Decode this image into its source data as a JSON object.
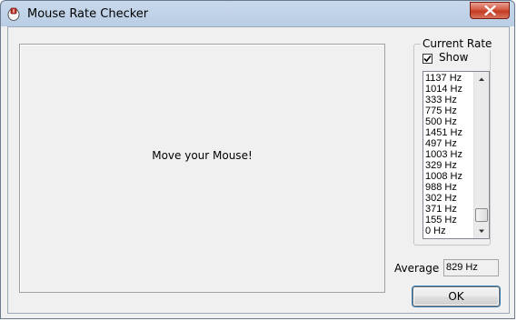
{
  "window": {
    "title": "Mouse Rate Checker"
  },
  "main": {
    "message": "Move your Mouse!"
  },
  "current_rate": {
    "group_label": "Current Rate",
    "show_label": "Show",
    "show_checked": true,
    "items": [
      "1137 Hz",
      "1014 Hz",
      "333 Hz",
      "775 Hz",
      "500 Hz",
      "1451 Hz",
      "497 Hz",
      "1003 Hz",
      "329 Hz",
      "1008 Hz",
      "988 Hz",
      "302 Hz",
      "371 Hz",
      "155 Hz",
      "0 Hz"
    ]
  },
  "average": {
    "label": "Average",
    "value": "829 Hz"
  },
  "buttons": {
    "ok_label": "OK"
  },
  "colors": {
    "title_bar": "#b9cde4",
    "close_button": "#c23a22",
    "dialog_bg": "#f0f0f0"
  },
  "icons": {
    "app": "mouse-app-icon",
    "close": "close-icon",
    "scroll_up": "arrow-up-icon",
    "scroll_down": "arrow-down-icon",
    "check": "checkmark-icon"
  }
}
